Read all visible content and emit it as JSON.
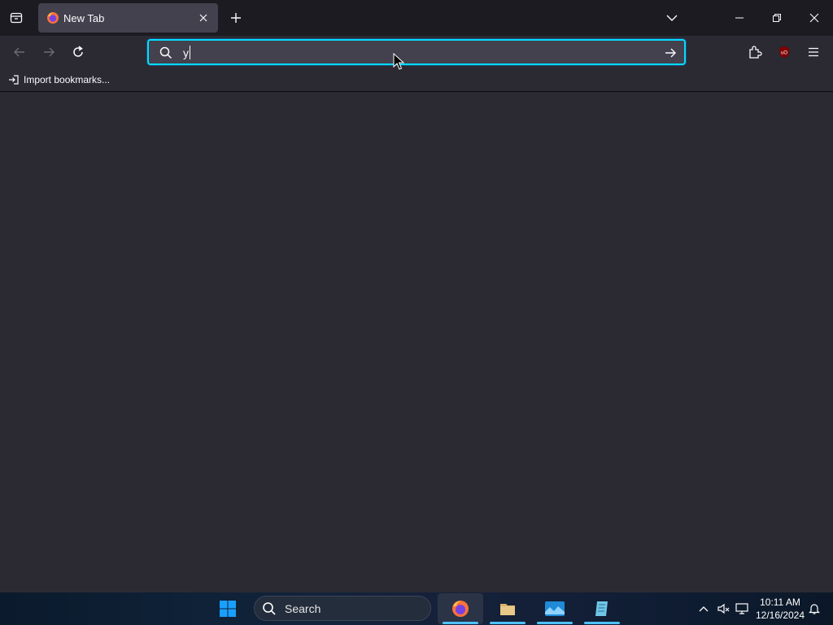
{
  "browser": {
    "tabs": [
      {
        "title": "New Tab",
        "active": true
      }
    ],
    "urlbar": {
      "value": "y",
      "placeholder": ""
    },
    "bookmarks_bar": {
      "items": [
        {
          "label": "Import bookmarks..."
        }
      ]
    }
  },
  "taskbar": {
    "search_label": "Search",
    "apps": [
      {
        "icon": "firefox-icon",
        "active": true
      },
      {
        "icon": "file-explorer-icon",
        "active": false
      },
      {
        "icon": "photos-icon",
        "active": false
      },
      {
        "icon": "notepad-icon",
        "active": false
      }
    ],
    "clock": {
      "time": "10:11 AM",
      "date": "12/16/2024"
    }
  },
  "colors": {
    "tabstrip_bg": "#1c1b22",
    "toolbar_bg": "#2b2a33",
    "urlbar_focus": "#00ddff",
    "accent": "#4cc2ff"
  }
}
